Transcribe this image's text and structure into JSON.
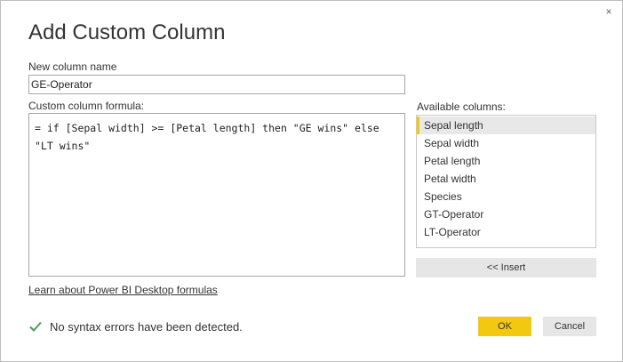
{
  "dialog": {
    "title": "Add Custom Column",
    "close_glyph": "×"
  },
  "name_field": {
    "label": "New column name",
    "value": "GE-Operator"
  },
  "formula_field": {
    "label": "Custom column formula:",
    "value": "= if [Sepal width] >= [Petal length] then \"GE wins\" else \"LT wins\""
  },
  "available_columns": {
    "label": "Available columns:",
    "items": [
      "Sepal length",
      "Sepal width",
      "Petal length",
      "Petal width",
      "Species",
      "GT-Operator",
      "LT-Operator"
    ],
    "selected_index": 0
  },
  "insert_button": {
    "label": "<< Insert"
  },
  "learn_link": {
    "label": "Learn about Power BI Desktop formulas"
  },
  "status": {
    "text": "No syntax errors have been detected.",
    "icon": "checkmark-icon",
    "color": "#4a9c5d"
  },
  "buttons": {
    "ok_label": "OK",
    "cancel_label": "Cancel"
  },
  "colors": {
    "accent": "#f2c811",
    "button_gray": "#e6e6e6"
  }
}
